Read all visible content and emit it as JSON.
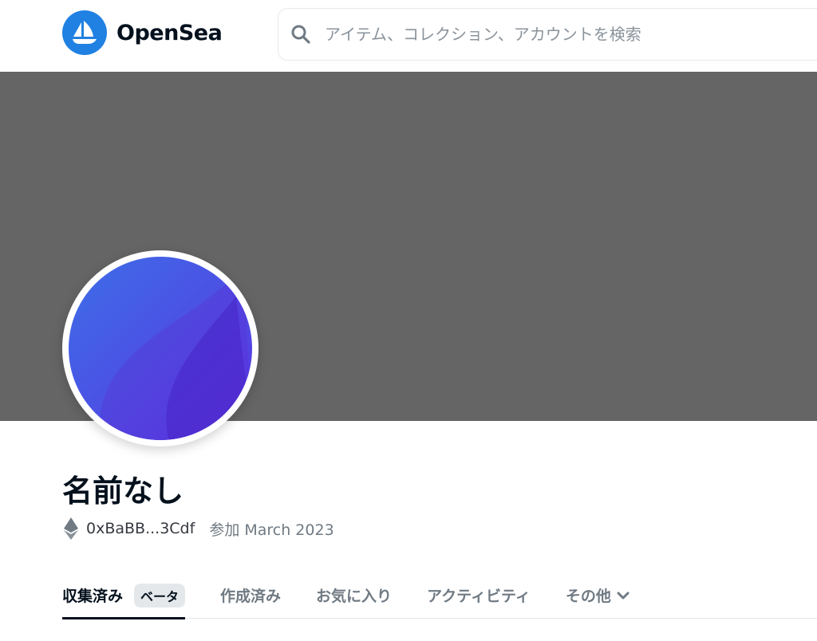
{
  "header": {
    "logo_text": "OpenSea",
    "search_placeholder": "アイテム、コレクション、アカウントを検索"
  },
  "profile": {
    "name": "名前なし",
    "address": "0xBaBB...3Cdf",
    "joined": "参加 March 2023"
  },
  "tabs": [
    {
      "label": "収集済み",
      "badge": "ベータ",
      "active": true
    },
    {
      "label": "作成済み"
    },
    {
      "label": "お気に入り"
    },
    {
      "label": "アクティビティ"
    },
    {
      "label": "その他"
    }
  ],
  "colors": {
    "brand": "#2081e2",
    "banner": "#656565",
    "avatar_gradient_start": "#3b6fe8",
    "avatar_gradient_end": "#5b2fe0"
  }
}
